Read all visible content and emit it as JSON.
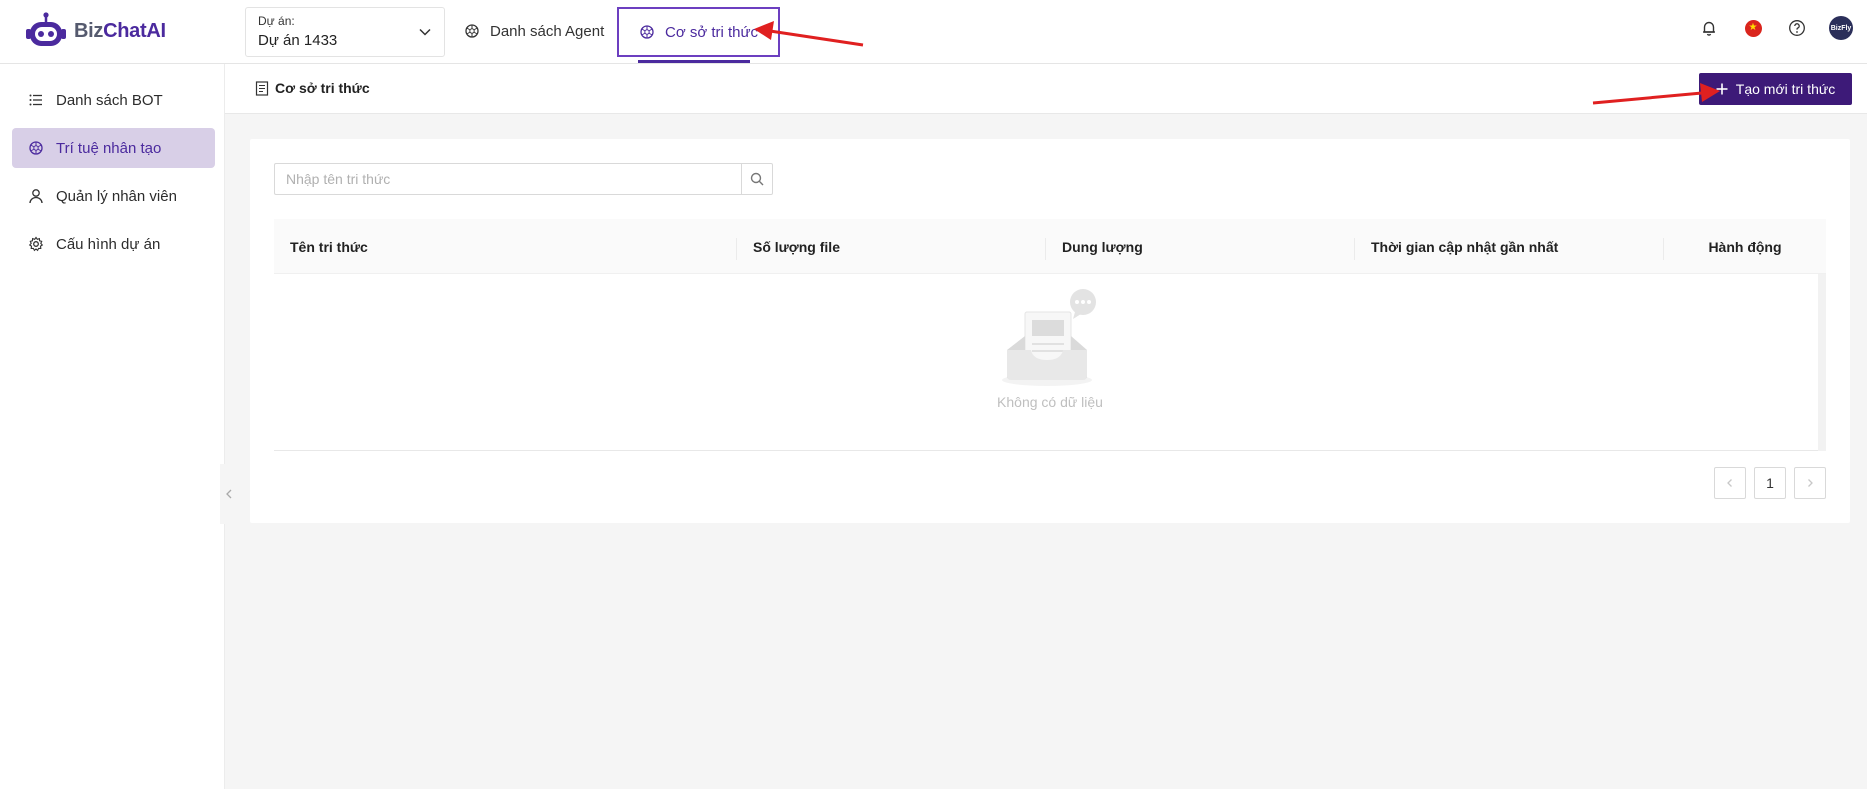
{
  "app": {
    "logo_part1": "Biz",
    "logo_part2": "ChatAI"
  },
  "header": {
    "project_label": "Dự án:",
    "project_value": "Dự án 1433",
    "tabs": [
      {
        "label": "Danh sách Agent",
        "active": false
      },
      {
        "label": "Cơ sở tri thức",
        "active": true
      }
    ],
    "avatar_text": "BizFly"
  },
  "sidebar": {
    "items": [
      {
        "label": "Danh sách BOT",
        "icon": "list-icon",
        "active": false
      },
      {
        "label": "Trí tuệ nhân tạo",
        "icon": "ai-icon",
        "active": true
      },
      {
        "label": "Quản lý nhân viên",
        "icon": "user-icon",
        "active": false
      },
      {
        "label": "Cấu hình dự án",
        "icon": "gear-icon",
        "active": false
      }
    ]
  },
  "page": {
    "breadcrumb": "Cơ sở tri thức",
    "create_button": "Tạo mới tri thức"
  },
  "search": {
    "placeholder": "Nhập tên tri thức",
    "value": ""
  },
  "table": {
    "columns": [
      "Tên tri thức",
      "Số lượng file",
      "Dung lượng",
      "Thời gian cập nhật gần nhất",
      "Hành động"
    ],
    "rows": [],
    "empty_text": "Không có dữ liệu"
  },
  "pagination": {
    "current_page": "1",
    "prev": "<",
    "next": ">"
  },
  "colors": {
    "brand": "#4b2a9e",
    "button": "#3d1a78",
    "active_bg": "#d8cfe7",
    "annotation_arrow": "#e02020"
  }
}
